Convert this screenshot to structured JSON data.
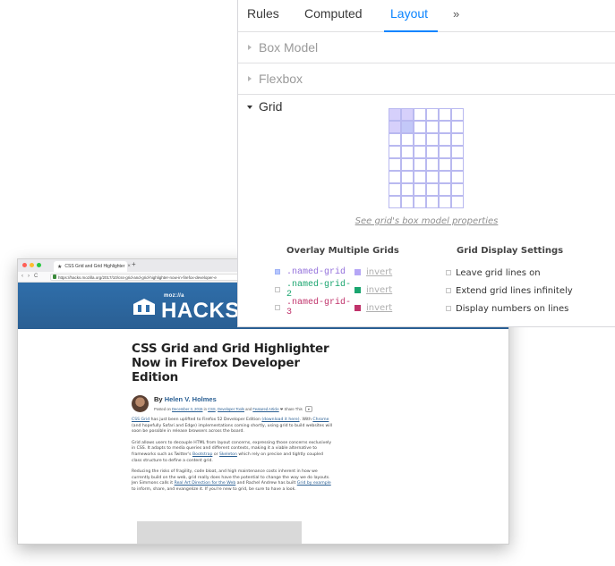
{
  "browser": {
    "tab_title": "CSS Grid and Grid Highlighter",
    "new_tab": "+",
    "tab_close": "×",
    "url": "https://hacks.mozilla.org/2017/10/css-grid-and-grid-highlighter-now-in-firefox-developer-e",
    "nav_back": "‹",
    "nav_forward": "›",
    "nav_reload": "C",
    "dot_colors": [
      "#ff5f57",
      "#febc2e",
      "#28c840"
    ],
    "logo_small": "moz://a",
    "logo_big": "HACKS",
    "hero_color": "#2f6eaa"
  },
  "article": {
    "title": "CSS Grid and Grid Highlighter Now in Firefox Developer Edition",
    "by": "By",
    "author": "Helen V. Holmes",
    "meta_prefix": "Posted on",
    "meta_date": "December 3, 2015",
    "meta_in": "in",
    "meta_cat1": "CSS",
    "meta_cat2": "Developer Tools",
    "meta_and": "and",
    "meta_cat3": "Featured Article",
    "share": "Share This",
    "p1_link1": "CSS Grid",
    "p1_text1": "has just been uplifted to Firefox 52 Developer Edition",
    "p1_link2": "(download it here)",
    "p1_text2": ". With",
    "p1_link3": "Chrome",
    "p1_text3": "(and hopefully Safari and Edge) implementations coming shortly, using grid to build websites will soon be possible in release browsers across the board.",
    "p2_text1": "Grid allows users to decouple HTML from layout concerns, expressing those concerns exclusively in CSS. It adapts to media queries and different contexts, making it a viable alternative to frameworks such as Twitter's",
    "p2_link1": "Bootstrap",
    "p2_text2": "or",
    "p2_link2": "Skeleton",
    "p2_text3": "which rely on precise and tightly coupled class structure to define a content grid.",
    "p3_text1": "Reducing the risks of fragility, code bloat, and high maintenance costs inherent in how we currently build on the web, grid really does have the potential to change the way we do layouts. Jen Simmons calls it",
    "p3_link1": "Real Art Direction for the Web",
    "p3_text2": "and Rachel Andrew has built",
    "p3_link2": "Grid by example",
    "p3_text3": "to inform, share, and evangelize it. If you're new to grid, be sure to have a look."
  },
  "devtools": {
    "tabs": [
      "Rules",
      "Computed",
      "Layout"
    ],
    "more": "»",
    "accent": "#0a84ff",
    "box_model": "Box Model",
    "flexbox": "Flexbox",
    "grid": "Grid",
    "box_model_link": "See grid's box model properties",
    "overlay_heading": "Overlay Multiple Grids",
    "settings_heading": "Grid Display Settings",
    "grids": [
      {
        "name": ".named-grid",
        "color": "#9370db",
        "checked": true,
        "invert": "invert"
      },
      {
        "name": ".named-grid-2",
        "color": "#1aa56f",
        "checked": false,
        "invert": "invert"
      },
      {
        "name": ".named-grid-3",
        "color": "#c0336b",
        "checked": false,
        "invert": "invert"
      }
    ],
    "settings": [
      {
        "label": "Leave grid lines on"
      },
      {
        "label": "Extend grid lines infinitely"
      },
      {
        "label": "Display numbers on lines"
      }
    ]
  }
}
